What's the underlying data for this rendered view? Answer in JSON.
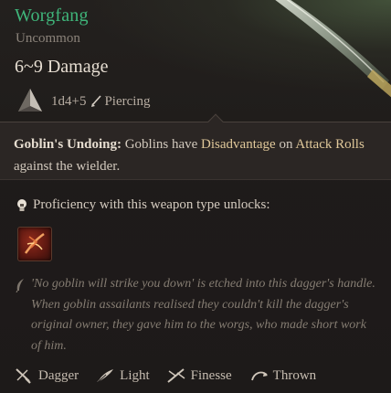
{
  "item": {
    "name": "Worgfang",
    "rarity": "Uncommon",
    "damage": "6~9 Damage",
    "dice": "1d4+5",
    "damage_type": "Piercing",
    "icons": {
      "weapon": "dagger-blade-image",
      "dice": "d4-die-icon",
      "damage_type": "piercing-icon"
    },
    "colors": {
      "rarity_name": "#3fb57a",
      "keyword": "#e0c89a"
    }
  },
  "passive": {
    "name": "Goblin's Undoing:",
    "text_parts": [
      "Goblins have",
      "Disadvantage",
      "on",
      "Attack Rolls",
      "against the wielder."
    ]
  },
  "proficiency": {
    "label": "Proficiency with this weapon type unlocks:",
    "icon": "lightbulb-icon",
    "action_icon": "flourish-action-icon"
  },
  "lore": {
    "icon": "quill-icon",
    "text": "'No goblin will strike you down' is etched into this dagger's handle. When goblin assailants realised they couldn't kill the dagger's original owner, they gave him to the worgs, who made short work of him."
  },
  "properties": [
    {
      "label": "Dagger",
      "icon": "dagger-icon"
    },
    {
      "label": "Light",
      "icon": "feather-icon"
    },
    {
      "label": "Finesse",
      "icon": "finesse-icon"
    },
    {
      "label": "Thrown",
      "icon": "thrown-icon"
    }
  ]
}
